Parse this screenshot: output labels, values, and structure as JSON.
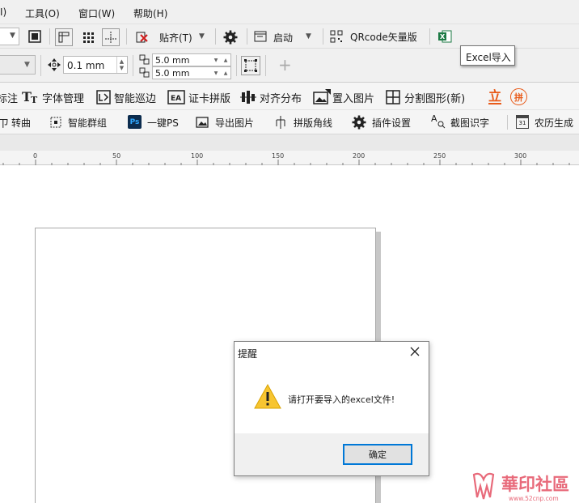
{
  "menubar": {
    "items": [
      {
        "label": "I)"
      },
      {
        "label": "工具(O)"
      },
      {
        "label": "窗口(W)"
      },
      {
        "label": "帮助(H)"
      }
    ]
  },
  "toolbar1": {
    "snap_label": "贴齐(T)",
    "launch_label": "启动",
    "qrcode_label": "QRcode矢量版"
  },
  "toolbar2": {
    "outline_width": "0.1 mm",
    "offset_x": "5.0 mm",
    "offset_y": "5.0 mm"
  },
  "tooltip": {
    "text": "Excel导入"
  },
  "toolbar3": {
    "items": [
      {
        "label": "标注"
      },
      {
        "label": "字体管理"
      },
      {
        "label": "智能巡边"
      },
      {
        "label": "证卡拼版"
      },
      {
        "label": "对齐分布"
      },
      {
        "label": "置入图片"
      },
      {
        "label": "分割图形(新)"
      }
    ],
    "icon_text_ting": "立",
    "icon_text_pin": "拼"
  },
  "toolbar4": {
    "items": [
      {
        "label": "转曲"
      },
      {
        "label": "智能群组"
      },
      {
        "label": "一键PS"
      },
      {
        "label": "导出图片"
      },
      {
        "label": "拼版角线"
      },
      {
        "label": "插件设置"
      },
      {
        "label": "截图识字"
      },
      {
        "label": "农历生成"
      }
    ],
    "ps_icon_text": "Ps",
    "ocr_icon_text": "A",
    "calendar_icon_text": "31"
  },
  "ruler": {
    "ticks": [
      "0",
      "50",
      "100",
      "150",
      "200",
      "250",
      "300"
    ]
  },
  "dialog": {
    "title": "提醒",
    "message": "请打开要导入的excel文件!",
    "ok_label": "确定"
  },
  "watermark": {
    "text": "華印社區",
    "url": "www.52cnp.com"
  },
  "colors": {
    "accent": "#0078d7",
    "warning": "#f7c531",
    "excel": "#1d7a45",
    "orange": "#e85b1a"
  }
}
